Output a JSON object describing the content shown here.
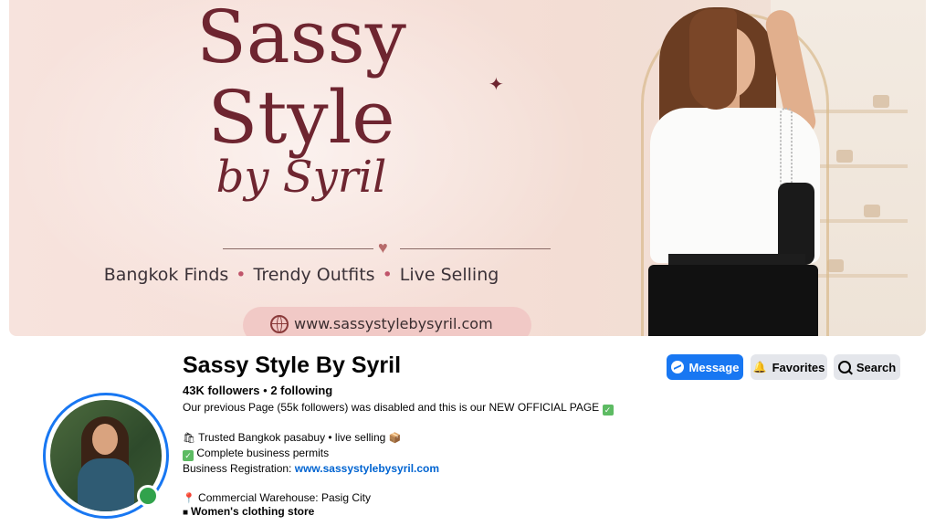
{
  "cover": {
    "brand_line1": "Sassy",
    "brand_line2": "Style",
    "brand_line3": "by Syril",
    "taglines": [
      "Bangkok Finds",
      "Trendy Outfits",
      "Live Selling"
    ],
    "url": "www.sassystylebysyril.com"
  },
  "profile": {
    "name": "Sassy Style By Syril",
    "followers": "43K followers",
    "separator": " • ",
    "following": "2 following",
    "bio_line1": "Our previous Page (55k followers) was disabled and this is our NEW OFFICIAL PAGE",
    "bio_line2": "Trusted Bangkok pasabuy • live selling",
    "bio_line3": "Complete business permits",
    "bio_line4_label": "Business Registration: ",
    "bio_line4_link": "www.sassystylebysyril.com",
    "bio_line5": "Commercial Warehouse: Pasig City",
    "category": "Women's clothing store"
  },
  "actions": {
    "message": "Message",
    "favorites": "Favorites",
    "search": "Search"
  },
  "colors": {
    "accent": "#1877f2",
    "secondary_button": "#e4e6eb",
    "online": "#31a24c",
    "brand": "#6e2530"
  }
}
